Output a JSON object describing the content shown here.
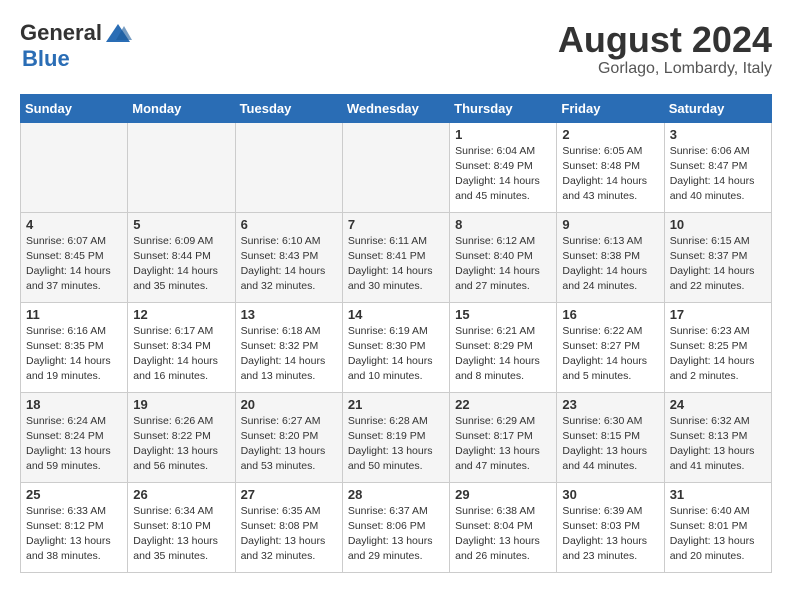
{
  "header": {
    "logo_general": "General",
    "logo_blue": "Blue",
    "month_title": "August 2024",
    "location": "Gorlago, Lombardy, Italy"
  },
  "weekdays": [
    "Sunday",
    "Monday",
    "Tuesday",
    "Wednesday",
    "Thursday",
    "Friday",
    "Saturday"
  ],
  "weeks": [
    [
      {
        "day": "",
        "info": ""
      },
      {
        "day": "",
        "info": ""
      },
      {
        "day": "",
        "info": ""
      },
      {
        "day": "",
        "info": ""
      },
      {
        "day": "1",
        "info": "Sunrise: 6:04 AM\nSunset: 8:49 PM\nDaylight: 14 hours\nand 45 minutes."
      },
      {
        "day": "2",
        "info": "Sunrise: 6:05 AM\nSunset: 8:48 PM\nDaylight: 14 hours\nand 43 minutes."
      },
      {
        "day": "3",
        "info": "Sunrise: 6:06 AM\nSunset: 8:47 PM\nDaylight: 14 hours\nand 40 minutes."
      }
    ],
    [
      {
        "day": "4",
        "info": "Sunrise: 6:07 AM\nSunset: 8:45 PM\nDaylight: 14 hours\nand 37 minutes."
      },
      {
        "day": "5",
        "info": "Sunrise: 6:09 AM\nSunset: 8:44 PM\nDaylight: 14 hours\nand 35 minutes."
      },
      {
        "day": "6",
        "info": "Sunrise: 6:10 AM\nSunset: 8:43 PM\nDaylight: 14 hours\nand 32 minutes."
      },
      {
        "day": "7",
        "info": "Sunrise: 6:11 AM\nSunset: 8:41 PM\nDaylight: 14 hours\nand 30 minutes."
      },
      {
        "day": "8",
        "info": "Sunrise: 6:12 AM\nSunset: 8:40 PM\nDaylight: 14 hours\nand 27 minutes."
      },
      {
        "day": "9",
        "info": "Sunrise: 6:13 AM\nSunset: 8:38 PM\nDaylight: 14 hours\nand 24 minutes."
      },
      {
        "day": "10",
        "info": "Sunrise: 6:15 AM\nSunset: 8:37 PM\nDaylight: 14 hours\nand 22 minutes."
      }
    ],
    [
      {
        "day": "11",
        "info": "Sunrise: 6:16 AM\nSunset: 8:35 PM\nDaylight: 14 hours\nand 19 minutes."
      },
      {
        "day": "12",
        "info": "Sunrise: 6:17 AM\nSunset: 8:34 PM\nDaylight: 14 hours\nand 16 minutes."
      },
      {
        "day": "13",
        "info": "Sunrise: 6:18 AM\nSunset: 8:32 PM\nDaylight: 14 hours\nand 13 minutes."
      },
      {
        "day": "14",
        "info": "Sunrise: 6:19 AM\nSunset: 8:30 PM\nDaylight: 14 hours\nand 10 minutes."
      },
      {
        "day": "15",
        "info": "Sunrise: 6:21 AM\nSunset: 8:29 PM\nDaylight: 14 hours\nand 8 minutes."
      },
      {
        "day": "16",
        "info": "Sunrise: 6:22 AM\nSunset: 8:27 PM\nDaylight: 14 hours\nand 5 minutes."
      },
      {
        "day": "17",
        "info": "Sunrise: 6:23 AM\nSunset: 8:25 PM\nDaylight: 14 hours\nand 2 minutes."
      }
    ],
    [
      {
        "day": "18",
        "info": "Sunrise: 6:24 AM\nSunset: 8:24 PM\nDaylight: 13 hours\nand 59 minutes."
      },
      {
        "day": "19",
        "info": "Sunrise: 6:26 AM\nSunset: 8:22 PM\nDaylight: 13 hours\nand 56 minutes."
      },
      {
        "day": "20",
        "info": "Sunrise: 6:27 AM\nSunset: 8:20 PM\nDaylight: 13 hours\nand 53 minutes."
      },
      {
        "day": "21",
        "info": "Sunrise: 6:28 AM\nSunset: 8:19 PM\nDaylight: 13 hours\nand 50 minutes."
      },
      {
        "day": "22",
        "info": "Sunrise: 6:29 AM\nSunset: 8:17 PM\nDaylight: 13 hours\nand 47 minutes."
      },
      {
        "day": "23",
        "info": "Sunrise: 6:30 AM\nSunset: 8:15 PM\nDaylight: 13 hours\nand 44 minutes."
      },
      {
        "day": "24",
        "info": "Sunrise: 6:32 AM\nSunset: 8:13 PM\nDaylight: 13 hours\nand 41 minutes."
      }
    ],
    [
      {
        "day": "25",
        "info": "Sunrise: 6:33 AM\nSunset: 8:12 PM\nDaylight: 13 hours\nand 38 minutes."
      },
      {
        "day": "26",
        "info": "Sunrise: 6:34 AM\nSunset: 8:10 PM\nDaylight: 13 hours\nand 35 minutes."
      },
      {
        "day": "27",
        "info": "Sunrise: 6:35 AM\nSunset: 8:08 PM\nDaylight: 13 hours\nand 32 minutes."
      },
      {
        "day": "28",
        "info": "Sunrise: 6:37 AM\nSunset: 8:06 PM\nDaylight: 13 hours\nand 29 minutes."
      },
      {
        "day": "29",
        "info": "Sunrise: 6:38 AM\nSunset: 8:04 PM\nDaylight: 13 hours\nand 26 minutes."
      },
      {
        "day": "30",
        "info": "Sunrise: 6:39 AM\nSunset: 8:03 PM\nDaylight: 13 hours\nand 23 minutes."
      },
      {
        "day": "31",
        "info": "Sunrise: 6:40 AM\nSunset: 8:01 PM\nDaylight: 13 hours\nand 20 minutes."
      }
    ]
  ]
}
